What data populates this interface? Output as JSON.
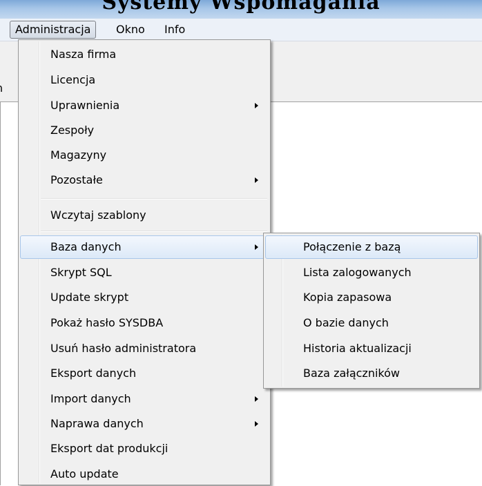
{
  "window": {
    "title": "Systemy Wspomagania"
  },
  "menubar": {
    "items": [
      {
        "label": "Administracja"
      },
      {
        "label": "Okno"
      },
      {
        "label": "Info"
      }
    ]
  },
  "left_fragment": "n",
  "admin_menu": {
    "items": [
      {
        "label": "Nasza firma"
      },
      {
        "label": "Licencja"
      },
      {
        "label": "Uprawnienia",
        "has_submenu": true
      },
      {
        "label": "Zespoły"
      },
      {
        "label": "Magazyny"
      },
      {
        "label": "Pozostałe",
        "has_submenu": true
      },
      {
        "label": "Wczytaj szablony"
      },
      {
        "label": "Baza danych",
        "has_submenu": true,
        "highlighted": true
      },
      {
        "label": "Skrypt SQL"
      },
      {
        "label": "Update skrypt"
      },
      {
        "label": "Pokaż hasło SYSDBA"
      },
      {
        "label": "Usuń hasło administratora"
      },
      {
        "label": "Eksport danych"
      },
      {
        "label": "Import danych",
        "has_submenu": true
      },
      {
        "label": "Naprawa danych",
        "has_submenu": true
      },
      {
        "label": "Eksport dat produkcji"
      },
      {
        "label": "Auto update"
      }
    ]
  },
  "baza_danych_submenu": {
    "items": [
      {
        "label": "Połączenie z bazą",
        "highlighted": true
      },
      {
        "label": "Lista zalogowanych"
      },
      {
        "label": "Kopia zapasowa"
      },
      {
        "label": "O bazie danych"
      },
      {
        "label": "Historia aktualizacji"
      },
      {
        "label": "Baza załączników"
      }
    ]
  }
}
